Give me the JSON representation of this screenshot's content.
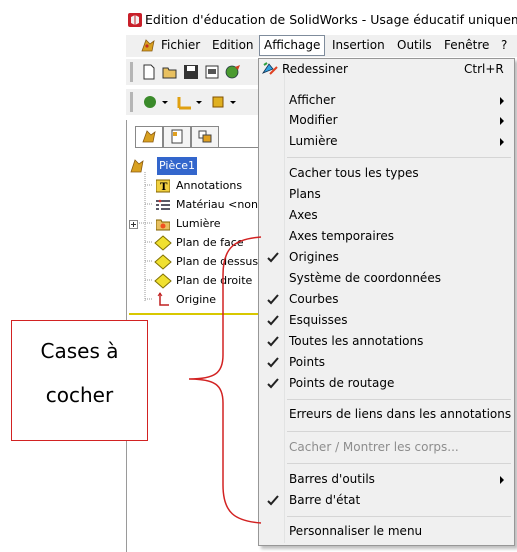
{
  "window": {
    "title": "Edition d'éducation de SolidWorks - Usage éducatif uniquement"
  },
  "menubar": {
    "items": [
      "Fichier",
      "Edition",
      "Affichage",
      "Insertion",
      "Outils",
      "Fenêtre",
      "?"
    ],
    "active": "Affichage"
  },
  "feature_tree": {
    "root": "Pièce1",
    "items": [
      "Annotations",
      "Matériau <non",
      "Lumière",
      "Plan de face",
      "Plan de dessus",
      "Plan de droite",
      "Origine"
    ]
  },
  "dropdown": {
    "redraw": {
      "label": "Redessiner",
      "shortcut": "Ctrl+R"
    },
    "display": "Afficher",
    "modify": "Modifier",
    "light": "Lumière",
    "hide_all_types": "Cacher tous les types",
    "planes": "Plans",
    "axes": "Axes",
    "temp_axes": "Axes temporaires",
    "origins": "Origines",
    "coord_systems": "Système de coordonnées",
    "curves": "Courbes",
    "sketches": "Esquisses",
    "all_annotations": "Toutes les annotations",
    "points": "Points",
    "routing_points": "Points de routage",
    "link_errors": "Erreurs de liens dans les annotations",
    "hide_show_bodies": "Cacher / Montrer les corps...",
    "toolbars": "Barres d'outils",
    "status_bar": "Barre d'état",
    "customize_menu": "Personnaliser le menu"
  },
  "callout": {
    "line1": "Cases à",
    "line2": "cocher"
  },
  "colors": {
    "callout_border": "#d22222",
    "menu_bg": "#f0f0f0",
    "tree_separator": "#d8c800"
  }
}
